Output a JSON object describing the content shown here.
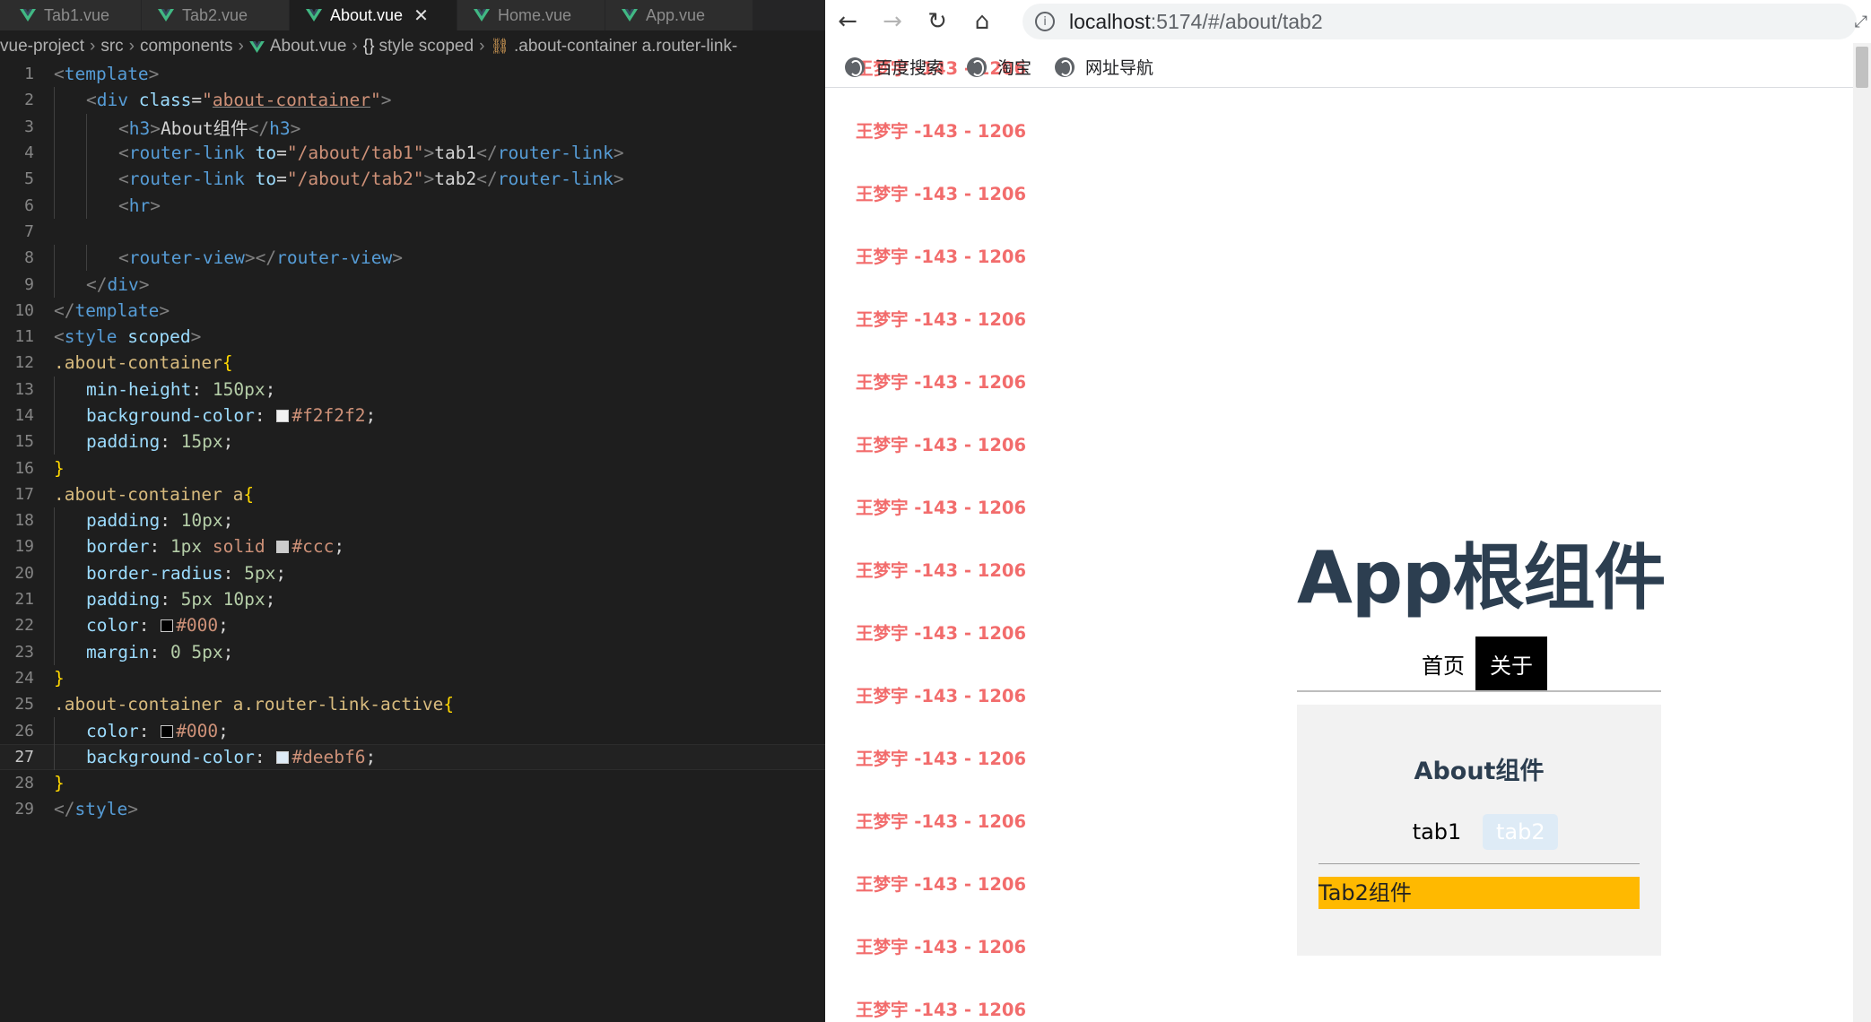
{
  "editor": {
    "tabs": [
      {
        "label": "Tab1.vue",
        "active": false
      },
      {
        "label": "Tab2.vue",
        "active": false
      },
      {
        "label": "About.vue",
        "active": true
      },
      {
        "label": "Home.vue",
        "active": false
      },
      {
        "label": "App.vue",
        "active": false
      }
    ],
    "close_glyph": "✕",
    "breadcrumbs": {
      "root": "vue-project",
      "src": "src",
      "components": "components",
      "file": "About.vue",
      "scope": "style scoped",
      "selector": ".about-container a.router-link-"
    },
    "lines": [
      {
        "n": "1",
        "segs": [
          {
            "t": "<",
            "c": "ang"
          },
          {
            "t": "template",
            "c": "tag"
          },
          {
            "t": ">",
            "c": "ang"
          }
        ]
      },
      {
        "n": "2",
        "segs": [
          {
            "t": "<",
            "c": "ang"
          },
          {
            "t": "div ",
            "c": "tag"
          },
          {
            "t": "class",
            "c": "attr"
          },
          {
            "t": "=",
            "c": "plain"
          },
          {
            "t": "\"",
            "c": "str"
          },
          {
            "t": "about-container",
            "c": "str",
            "u": true
          },
          {
            "t": "\"",
            "c": "str"
          },
          {
            "t": ">",
            "c": "ang"
          }
        ]
      },
      {
        "n": "3",
        "segs": [
          {
            "t": "<",
            "c": "ang"
          },
          {
            "t": "h3",
            "c": "tag"
          },
          {
            "t": ">",
            "c": "ang"
          },
          {
            "t": "About组件",
            "c": "plain"
          },
          {
            "t": "</",
            "c": "ang"
          },
          {
            "t": "h3",
            "c": "tag"
          },
          {
            "t": ">",
            "c": "ang"
          }
        ]
      },
      {
        "n": "4",
        "segs": [
          {
            "t": "<",
            "c": "ang"
          },
          {
            "t": "router-link ",
            "c": "tag"
          },
          {
            "t": "to",
            "c": "attr"
          },
          {
            "t": "=",
            "c": "plain"
          },
          {
            "t": "\"/about/tab1\"",
            "c": "str"
          },
          {
            "t": ">",
            "c": "ang"
          },
          {
            "t": "tab1",
            "c": "plain"
          },
          {
            "t": "</",
            "c": "ang"
          },
          {
            "t": "router-link",
            "c": "tag"
          },
          {
            "t": ">",
            "c": "ang"
          }
        ]
      },
      {
        "n": "5",
        "segs": [
          {
            "t": "<",
            "c": "ang"
          },
          {
            "t": "router-link ",
            "c": "tag"
          },
          {
            "t": "to",
            "c": "attr"
          },
          {
            "t": "=",
            "c": "plain"
          },
          {
            "t": "\"/about/tab2\"",
            "c": "str"
          },
          {
            "t": ">",
            "c": "ang"
          },
          {
            "t": "tab2",
            "c": "plain"
          },
          {
            "t": "</",
            "c": "ang"
          },
          {
            "t": "router-link",
            "c": "tag"
          },
          {
            "t": ">",
            "c": "ang"
          }
        ]
      },
      {
        "n": "6",
        "segs": [
          {
            "t": "<",
            "c": "ang"
          },
          {
            "t": "hr",
            "c": "tag"
          },
          {
            "t": ">",
            "c": "ang"
          }
        ]
      },
      {
        "n": "7",
        "segs": []
      },
      {
        "n": "8",
        "segs": [
          {
            "t": "<",
            "c": "ang"
          },
          {
            "t": "router-view",
            "c": "tag"
          },
          {
            "t": "></",
            "c": "ang"
          },
          {
            "t": "router-view",
            "c": "tag"
          },
          {
            "t": ">",
            "c": "ang"
          }
        ]
      },
      {
        "n": "9",
        "segs": [
          {
            "t": "</",
            "c": "ang"
          },
          {
            "t": "div",
            "c": "tag"
          },
          {
            "t": ">",
            "c": "ang"
          }
        ]
      },
      {
        "n": "10",
        "segs": [
          {
            "t": "</",
            "c": "ang"
          },
          {
            "t": "template",
            "c": "tag"
          },
          {
            "t": ">",
            "c": "ang"
          }
        ]
      },
      {
        "n": "11",
        "segs": [
          {
            "t": "<",
            "c": "ang"
          },
          {
            "t": "style ",
            "c": "tag"
          },
          {
            "t": "scoped",
            "c": "attr"
          },
          {
            "t": ">",
            "c": "ang"
          }
        ]
      },
      {
        "n": "12",
        "segs": [
          {
            "t": ".about-container",
            "c": "sel"
          },
          {
            "t": "{",
            "c": "brace"
          }
        ]
      },
      {
        "n": "13",
        "segs": [
          {
            "t": "min-height",
            "c": "prop"
          },
          {
            "t": ": ",
            "c": "plain"
          },
          {
            "t": "150px",
            "c": "num"
          },
          {
            "t": ";",
            "c": "plain"
          }
        ]
      },
      {
        "n": "14",
        "segs": [
          {
            "t": "background-color",
            "c": "prop"
          },
          {
            "t": ": ",
            "c": "plain"
          },
          {
            "sw": "#f2f2f2"
          },
          {
            "t": "#f2f2f2",
            "c": "val"
          },
          {
            "t": ";",
            "c": "plain"
          }
        ]
      },
      {
        "n": "15",
        "segs": [
          {
            "t": "padding",
            "c": "prop"
          },
          {
            "t": ": ",
            "c": "plain"
          },
          {
            "t": "15px",
            "c": "num"
          },
          {
            "t": ";",
            "c": "plain"
          }
        ]
      },
      {
        "n": "16",
        "segs": [
          {
            "t": "}",
            "c": "brace"
          }
        ]
      },
      {
        "n": "17",
        "segs": [
          {
            "t": ".about-container a",
            "c": "sel"
          },
          {
            "t": "{",
            "c": "brace"
          }
        ]
      },
      {
        "n": "18",
        "segs": [
          {
            "t": "padding",
            "c": "prop"
          },
          {
            "t": ": ",
            "c": "plain"
          },
          {
            "t": "10px",
            "c": "num"
          },
          {
            "t": ";",
            "c": "plain"
          }
        ]
      },
      {
        "n": "19",
        "segs": [
          {
            "t": "border",
            "c": "prop"
          },
          {
            "t": ": ",
            "c": "plain"
          },
          {
            "t": "1px ",
            "c": "num"
          },
          {
            "t": "solid ",
            "c": "val"
          },
          {
            "sw": "#cccccc"
          },
          {
            "t": "#ccc",
            "c": "val"
          },
          {
            "t": ";",
            "c": "plain"
          }
        ]
      },
      {
        "n": "20",
        "segs": [
          {
            "t": "border-radius",
            "c": "prop"
          },
          {
            "t": ": ",
            "c": "plain"
          },
          {
            "t": "5px",
            "c": "num"
          },
          {
            "t": ";",
            "c": "plain"
          }
        ]
      },
      {
        "n": "21",
        "segs": [
          {
            "t": "padding",
            "c": "prop"
          },
          {
            "t": ": ",
            "c": "plain"
          },
          {
            "t": "5px 10px",
            "c": "num"
          },
          {
            "t": ";",
            "c": "plain"
          }
        ]
      },
      {
        "n": "22",
        "segs": [
          {
            "t": "color",
            "c": "prop"
          },
          {
            "t": ": ",
            "c": "plain"
          },
          {
            "sw": "#000000"
          },
          {
            "t": "#000",
            "c": "val"
          },
          {
            "t": ";",
            "c": "plain"
          }
        ]
      },
      {
        "n": "23",
        "segs": [
          {
            "t": "margin",
            "c": "prop"
          },
          {
            "t": ": ",
            "c": "plain"
          },
          {
            "t": "0 5px",
            "c": "num"
          },
          {
            "t": ";",
            "c": "plain"
          }
        ]
      },
      {
        "n": "24",
        "segs": [
          {
            "t": "}",
            "c": "brace"
          }
        ]
      },
      {
        "n": "25",
        "segs": [
          {
            "t": ".about-container a.router-link-active",
            "c": "sel"
          },
          {
            "t": "{",
            "c": "brace"
          }
        ]
      },
      {
        "n": "26",
        "segs": [
          {
            "t": "color",
            "c": "prop"
          },
          {
            "t": ": ",
            "c": "plain"
          },
          {
            "sw": "#000000"
          },
          {
            "t": "#000",
            "c": "val"
          },
          {
            "t": ";",
            "c": "plain"
          }
        ]
      },
      {
        "n": "27",
        "segs": [
          {
            "t": "background-color",
            "c": "prop"
          },
          {
            "t": ": ",
            "c": "plain"
          },
          {
            "sw": "#deebf6"
          },
          {
            "t": "#deebf6",
            "c": "val"
          },
          {
            "t": ";",
            "c": "plain"
          }
        ]
      },
      {
        "n": "28",
        "segs": [
          {
            "t": "}",
            "c": "brace"
          }
        ]
      },
      {
        "n": "29",
        "segs": [
          {
            "t": "</",
            "c": "ang"
          },
          {
            "t": "style",
            "c": "tag"
          },
          {
            "t": ">",
            "c": "ang"
          }
        ]
      }
    ],
    "current_line": "27",
    "colors": {
      "background": "#1e1e1e",
      "tag": "#569cd6",
      "string": "#ce9178",
      "selector": "#d7ba7d"
    }
  },
  "browser": {
    "url_host": "localhost",
    "url_path": ":5174/#/about/tab2",
    "info_glyph": "i",
    "bookmarks": [
      "百度搜索",
      "淘宝",
      "网址导航"
    ],
    "repeated_name": "王梦宇 -143 - 1206",
    "app_title": "App根组件",
    "nav": [
      {
        "label": "首页",
        "active": false
      },
      {
        "label": "关于",
        "active": true
      }
    ],
    "about_title": "About组件",
    "about_links": [
      {
        "label": "tab1",
        "active": false
      },
      {
        "label": "tab2",
        "active": true
      }
    ],
    "tab2_content": "Tab2组件",
    "colors": {
      "name_text": "#f26c6c",
      "tab2_bg": "#ffb900",
      "about_bg": "#f2f2f2",
      "active_link_bg": "#deebf6"
    }
  }
}
